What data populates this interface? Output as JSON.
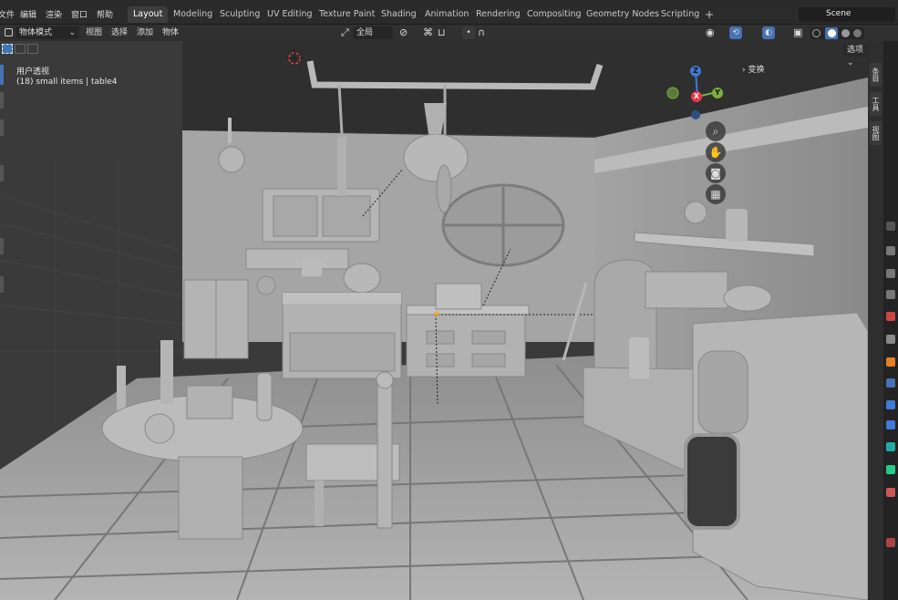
{
  "topmenu": [
    "文件",
    "编辑",
    "渲染",
    "窗口",
    "帮助"
  ],
  "workspaces": [
    "Layout",
    "Modeling",
    "Sculpting",
    "UV Editing",
    "Texture Paint",
    "Shading",
    "Animation",
    "Rendering",
    "Compositing",
    "Geometry Nodes",
    "Scripting"
  ],
  "add_tab": "+",
  "scene": "Scene",
  "header": {
    "mode": "物体模式",
    "view": "视图",
    "select": "选择",
    "add": "添加",
    "object": "物体",
    "transform_orientation": "全局",
    "options": "选项"
  },
  "viewport": {
    "perspective": "用户透视",
    "collection": "(18) small items | table4"
  },
  "npanel": {
    "transform": "变换",
    "tabs": [
      "条目",
      "工具",
      "视图"
    ]
  },
  "gizmo": {
    "x": "X",
    "y": "Y",
    "z": "Z"
  },
  "colors": {
    "x": "#e8374a",
    "y": "#7ab03b",
    "z": "#3e7ad6",
    "accent": "#4772b3"
  }
}
